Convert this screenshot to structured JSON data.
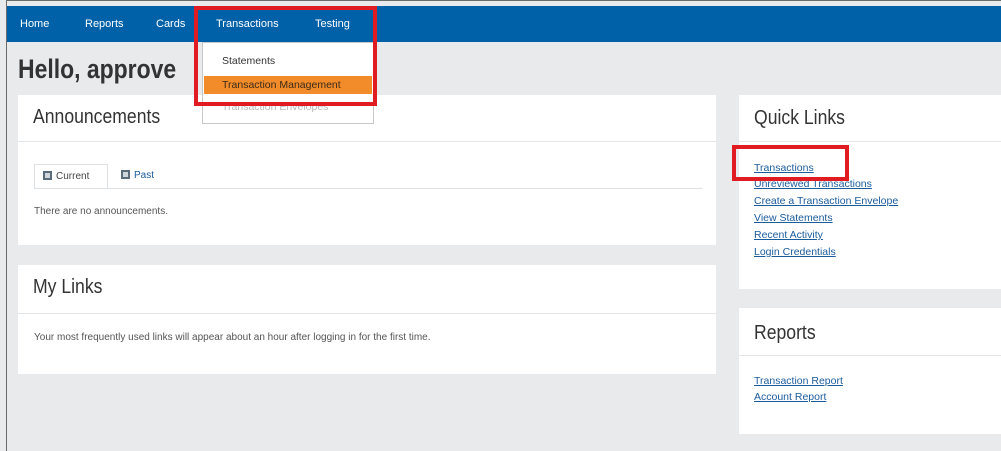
{
  "nav": {
    "items": [
      "Home",
      "Reports",
      "Cards",
      "Transactions",
      "Testing"
    ]
  },
  "dropdown": {
    "items": [
      "Statements",
      "Transaction Management",
      "Transaction Envelopes"
    ],
    "active": "Transaction Management"
  },
  "greeting": "Hello, approve",
  "announcements": {
    "title": "Announcements",
    "tabs": [
      "Current",
      "Past"
    ],
    "empty_text": "There are no announcements."
  },
  "my_links": {
    "title": "My Links",
    "text": "Your most frequently used links will appear about an hour after logging in for the first time."
  },
  "quick_links": {
    "title": "Quick Links",
    "links": [
      "Transactions",
      "Unreviewed Transactions",
      "Create a Transaction Envelope",
      "View Statements",
      "Recent Activity",
      "Login Credentials"
    ]
  },
  "reports": {
    "title": "Reports",
    "links": [
      "Transaction Report",
      "Account Report"
    ]
  },
  "colors": {
    "navbar": "#0061a8",
    "highlight": "#e11b22",
    "active_menu": "#f28c2a",
    "link": "#1a5b9c"
  }
}
